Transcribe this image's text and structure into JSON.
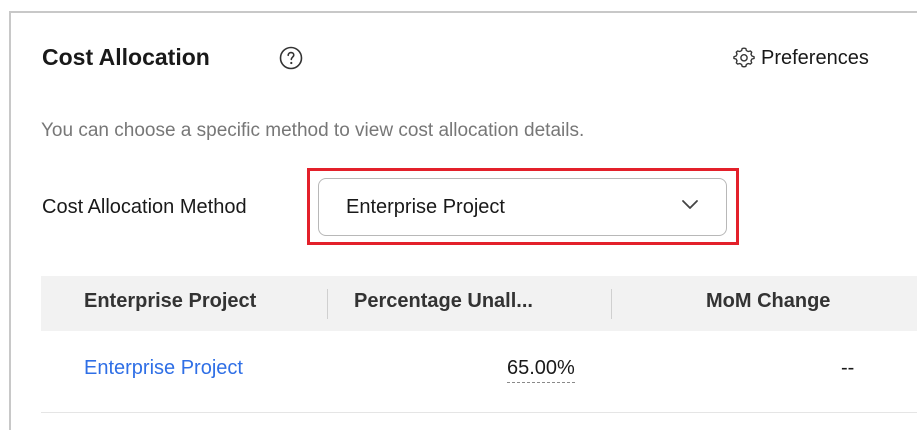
{
  "panel": {
    "title": "Cost Allocation",
    "help_icon": "question-circle-icon",
    "preferences_label": "Preferences",
    "preferences_icon": "gear-icon",
    "description": "You can choose a specific method to view cost allocation details."
  },
  "method": {
    "label": "Cost Allocation Method",
    "selected": "Enterprise Project",
    "dropdown_icon": "chevron-down-icon",
    "highlight_color": "#e3202a"
  },
  "table": {
    "columns": [
      "Enterprise Project",
      "Percentage Unall...",
      "MoM Change"
    ],
    "rows": [
      {
        "project": "Enterprise Project",
        "percentage": "65.00%",
        "mom_change": "--"
      }
    ]
  },
  "colors": {
    "link": "#2f6fe6",
    "header_bg": "#f2f2f2"
  }
}
